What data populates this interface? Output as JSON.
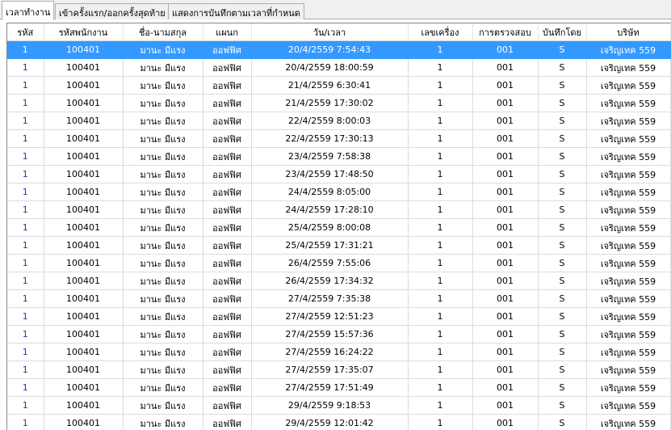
{
  "tabs": [
    {
      "label": "เวลาทำงาน",
      "active": true
    },
    {
      "label": "เข้าครั้งแรก/ออกครั้งสุดท้าย",
      "active": false
    },
    {
      "label": "แสดงการบันทึกตามเวลาที่กำหนด",
      "active": false
    }
  ],
  "table": {
    "columns": [
      "รหัส",
      "รหัสพนักงาน",
      "ชื่อ-นามสกุล",
      "แผนก",
      "วัน/เวลา",
      "เลขเครื่อง",
      "การตรวจสอบ",
      "บันทึกโดย",
      "บริษัท"
    ],
    "selected_row": 0,
    "rows": [
      [
        "1",
        "100401",
        "มานะ มีแรง",
        "ออฟฟิศ",
        "20/4/2559 7:54:43",
        "1",
        "001",
        "S",
        "เจริญเทค 559"
      ],
      [
        "1",
        "100401",
        "มานะ มีแรง",
        "ออฟฟิศ",
        "20/4/2559 18:00:59",
        "1",
        "001",
        "S",
        "เจริญเทค 559"
      ],
      [
        "1",
        "100401",
        "มานะ มีแรง",
        "ออฟฟิศ",
        "21/4/2559 6:30:41",
        "1",
        "001",
        "S",
        "เจริญเทค 559"
      ],
      [
        "1",
        "100401",
        "มานะ มีแรง",
        "ออฟฟิศ",
        "21/4/2559 17:30:02",
        "1",
        "001",
        "S",
        "เจริญเทค 559"
      ],
      [
        "1",
        "100401",
        "มานะ มีแรง",
        "ออฟฟิศ",
        "22/4/2559 8:00:03",
        "1",
        "001",
        "S",
        "เจริญเทค 559"
      ],
      [
        "1",
        "100401",
        "มานะ มีแรง",
        "ออฟฟิศ",
        "22/4/2559 17:30:13",
        "1",
        "001",
        "S",
        "เจริญเทค 559"
      ],
      [
        "1",
        "100401",
        "มานะ มีแรง",
        "ออฟฟิศ",
        "23/4/2559 7:58:38",
        "1",
        "001",
        "S",
        "เจริญเทค 559"
      ],
      [
        "1",
        "100401",
        "มานะ มีแรง",
        "ออฟฟิศ",
        "23/4/2559 17:48:50",
        "1",
        "001",
        "S",
        "เจริญเทค 559"
      ],
      [
        "1",
        "100401",
        "มานะ มีแรง",
        "ออฟฟิศ",
        "24/4/2559 8:05:00",
        "1",
        "001",
        "S",
        "เจริญเทค 559"
      ],
      [
        "1",
        "100401",
        "มานะ มีแรง",
        "ออฟฟิศ",
        "24/4/2559 17:28:10",
        "1",
        "001",
        "S",
        "เจริญเทค 559"
      ],
      [
        "1",
        "100401",
        "มานะ มีแรง",
        "ออฟฟิศ",
        "25/4/2559 8:00:08",
        "1",
        "001",
        "S",
        "เจริญเทค 559"
      ],
      [
        "1",
        "100401",
        "มานะ มีแรง",
        "ออฟฟิศ",
        "25/4/2559 17:31:21",
        "1",
        "001",
        "S",
        "เจริญเทค 559"
      ],
      [
        "1",
        "100401",
        "มานะ มีแรง",
        "ออฟฟิศ",
        "26/4/2559 7:55:06",
        "1",
        "001",
        "S",
        "เจริญเทค 559"
      ],
      [
        "1",
        "100401",
        "มานะ มีแรง",
        "ออฟฟิศ",
        "26/4/2559 17:34:32",
        "1",
        "001",
        "S",
        "เจริญเทค 559"
      ],
      [
        "1",
        "100401",
        "มานะ มีแรง",
        "ออฟฟิศ",
        "27/4/2559 7:35:38",
        "1",
        "001",
        "S",
        "เจริญเทค 559"
      ],
      [
        "1",
        "100401",
        "มานะ มีแรง",
        "ออฟฟิศ",
        "27/4/2559 12:51:23",
        "1",
        "001",
        "S",
        "เจริญเทค 559"
      ],
      [
        "1",
        "100401",
        "มานะ มีแรง",
        "ออฟฟิศ",
        "27/4/2559 15:57:36",
        "1",
        "001",
        "S",
        "เจริญเทค 559"
      ],
      [
        "1",
        "100401",
        "มานะ มีแรง",
        "ออฟฟิศ",
        "27/4/2559 16:24:22",
        "1",
        "001",
        "S",
        "เจริญเทค 559"
      ],
      [
        "1",
        "100401",
        "มานะ มีแรง",
        "ออฟฟิศ",
        "27/4/2559 17:35:07",
        "1",
        "001",
        "S",
        "เจริญเทค 559"
      ],
      [
        "1",
        "100401",
        "มานะ มีแรง",
        "ออฟฟิศ",
        "27/4/2559 17:51:49",
        "1",
        "001",
        "S",
        "เจริญเทค 559"
      ],
      [
        "1",
        "100401",
        "มานะ มีแรง",
        "ออฟฟิศ",
        "29/4/2559 9:18:53",
        "1",
        "001",
        "S",
        "เจริญเทค 559"
      ],
      [
        "1",
        "100401",
        "มานะ มีแรง",
        "ออฟฟิศ",
        "29/4/2559 12:01:42",
        "1",
        "001",
        "S",
        "เจริญเทค 559"
      ]
    ]
  }
}
